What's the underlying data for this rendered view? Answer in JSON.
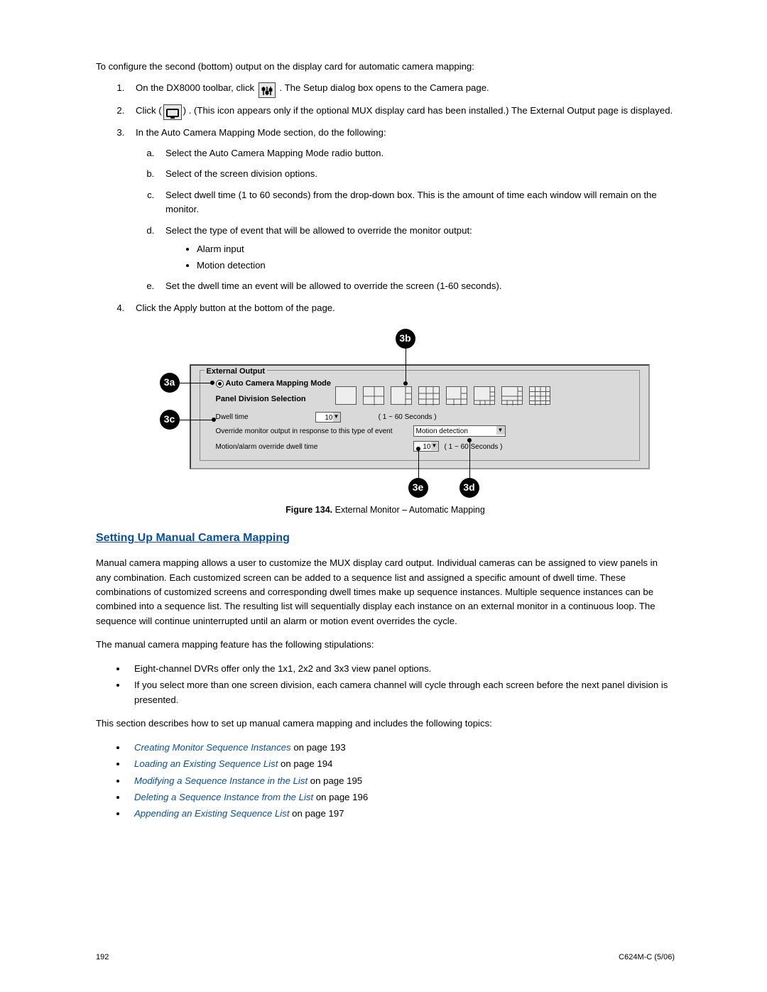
{
  "intro": "To configure the second (bottom) output on the display card for automatic camera mapping:",
  "steps": {
    "s1a": "On the DX8000 toolbar, click",
    "s1b": ". The Setup dialog box opens to the Camera page.",
    "s2a": "Click",
    "s2b": ". (This icon appears only if the optional MUX display card has been installed.) The External Output page is displayed.",
    "s3": "In the Auto Camera Mapping Mode section, do the following:",
    "s3a": "Select the Auto Camera Mapping Mode radio button.",
    "s3b": "Select of the screen division options.",
    "s3c": "Select dwell time (1 to 60 seconds) from the drop-down box. This is the amount of time each window will remain on the monitor.",
    "s3d": "Select the type of event that will be allowed to override the monitor output:",
    "s3d1": "Alarm input",
    "s3d2": "Motion detection",
    "s3e": "Set the dwell time an event will be allowed to override the screen (1-60 seconds).",
    "s4": "Click the Apply button at the bottom of the page."
  },
  "figure": {
    "group_title": "External Output",
    "radio_label": "Auto Camera Mapping Mode",
    "pds_label": "Panel Division Selection",
    "dwell_label": "Dwell time",
    "dwell_value": "10",
    "dwell_hint": "( 1 ~ 60 Seconds )",
    "override_label": "Override monitor output in response to this type of event",
    "override_value": "Motion detection",
    "ma_label": "Motion/alarm override dwell time",
    "ma_value": "10",
    "ma_hint": "( 1 ~ 60 Seconds )",
    "callouts": {
      "a": "3a",
      "b": "3b",
      "c": "3c",
      "d": "3d",
      "e": "3e"
    },
    "caption_bold": "Figure 134.",
    "caption_text": "  External Monitor – Automatic Mapping"
  },
  "section_head": "Setting Up Manual Camera Mapping",
  "para1": "Manual camera mapping allows a user to customize the MUX display card output. Individual cameras can be assigned to view panels in any combination. Each customized screen can be added to a sequence list and assigned a specific amount of dwell time. These combinations of customized screens and corresponding dwell times make up sequence instances. Multiple sequence instances can be combined into a sequence list. The resulting list will sequentially display each instance on an external monitor in a continuous loop. The sequence will continue uninterrupted until an alarm or motion event overrides the cycle.",
  "para2": "The manual camera mapping feature has the following stipulations:",
  "stip1": "Eight-channel DVRs offer only the 1x1, 2x2 and 3x3 view panel options.",
  "stip2": "If you select more than one screen division, each camera channel will cycle through each screen before the next panel division is presented.",
  "para3": "This section describes how to set up manual camera mapping and includes the following topics:",
  "topics": [
    {
      "link": "Creating Monitor Sequence Instances",
      "suffix": " on page 193"
    },
    {
      "link": "Loading an Existing Sequence List",
      "suffix": " on page 194"
    },
    {
      "link": "Modifying a Sequence Instance in the List",
      "suffix": " on page 195"
    },
    {
      "link": "Deleting a Sequence Instance from the List",
      "suffix": " on page 196"
    },
    {
      "link": "Appending an Existing Sequence List",
      "suffix": " on page 197"
    }
  ],
  "footer": {
    "left": "192",
    "right": "C624M-C (5/06)"
  }
}
